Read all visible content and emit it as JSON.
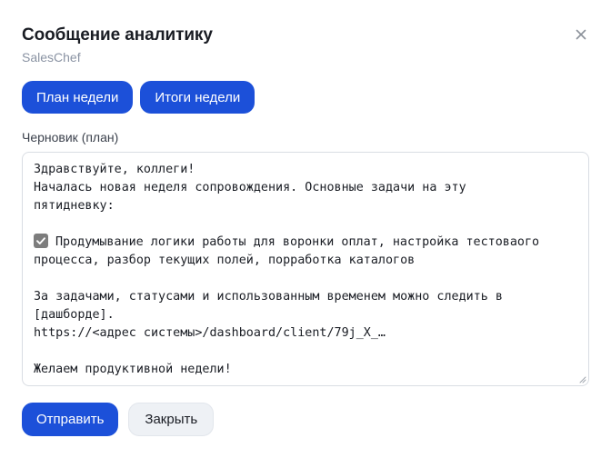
{
  "dialog": {
    "title": "Сообщение аналитику",
    "subtitle": "SalesChef",
    "close_icon": "close-icon"
  },
  "tabs": {
    "plan_label": "План недели",
    "results_label": "Итоги недели"
  },
  "draft": {
    "label": "Черновик (план)",
    "lines": {
      "greeting": "Здравствуйте, коллеги!",
      "intro_1": "Началась новая неделя сопровождения. Основные задачи на эту",
      "intro_2": "пятидневку:",
      "task_1": "Продумывание логики работы для воронки оплат, настройка тестоваого",
      "task_2": "процесса, разбор текущих полей, порработка каталогов",
      "tracking_1": "За задачами, статусами и использованным временем можно следить в",
      "tracking_2": "[дашборде].",
      "link": "https://<адрес системы>/dashboard/client/79j_X_…",
      "closing": "Желаем продуктивной недели!"
    },
    "task_checked": true,
    "checkbox_color": "#7d7d7d"
  },
  "footer": {
    "send_label": "Отправить",
    "close_label": "Закрыть"
  },
  "colors": {
    "accent": "#1c50d9",
    "secondary_bg": "#eef1f5",
    "subtitle_text": "#8a93a3"
  }
}
